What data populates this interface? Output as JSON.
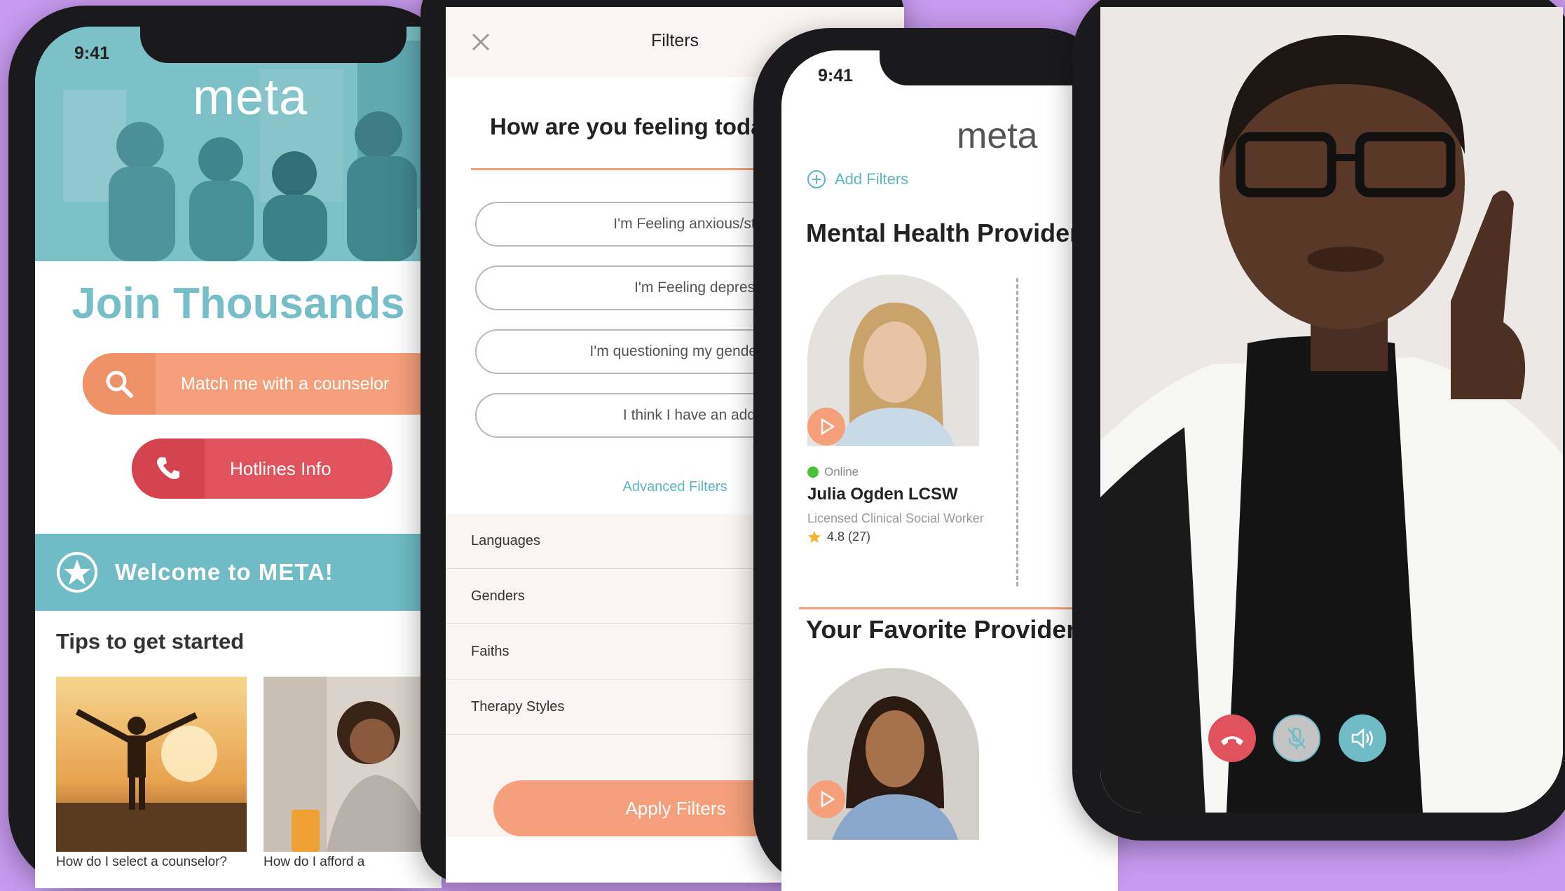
{
  "phone1": {
    "time": "9:41",
    "logo": "meta",
    "headline": "Join Thousands",
    "match_button": "Match me with a counselor",
    "hotlines_button": "Hotlines Info",
    "welcome_banner": "Welcome to META!",
    "tips_heading": "Tips to get started",
    "tip_captions": [
      "How do I select a counselor?",
      "How do I afford a"
    ]
  },
  "phone2": {
    "title": "Filters",
    "question": "How are you feeling today",
    "options": [
      "I'm Feeling anxious/stressed",
      "I'm Feeling depressed",
      "I'm questioning my gender/sexuality",
      "I think I have an addiction"
    ],
    "advanced_link": "Advanced Filters",
    "categories": [
      "Languages",
      "Genders",
      "Faiths",
      "Therapy Styles"
    ],
    "apply_button": "Apply Filters"
  },
  "phone3": {
    "time": "9:41",
    "logo": "meta",
    "add_filters": "Add Filters",
    "section1": "Mental Health Providers",
    "provider": {
      "status": "Online",
      "name": "Julia Ogden LCSW",
      "title": "Licensed Clinical Social Worker",
      "rating": "4.8 (27)"
    },
    "section2": "Your Favorite Providers"
  },
  "colors": {
    "teal": "#6fbcc6",
    "orange": "#f5a07a",
    "red": "#e0535c",
    "background": "#c89af0"
  }
}
